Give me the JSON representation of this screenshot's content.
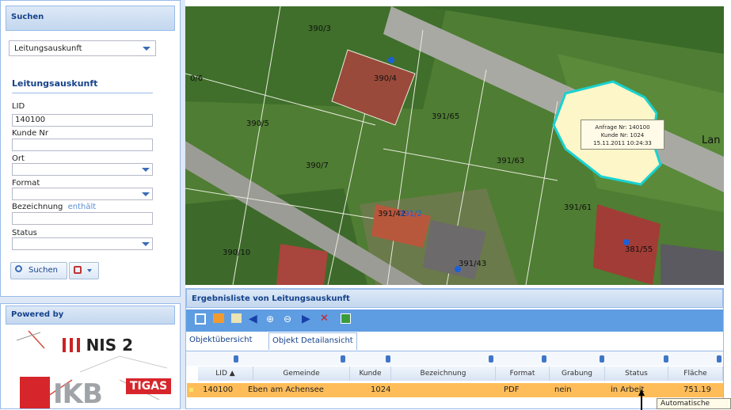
{
  "search_panel": {
    "title": "Suchen",
    "type_select": "Leitungsauskunft",
    "section_title": "Leitungsauskunft",
    "lid_label": "LID",
    "lid_value": "140100",
    "kunde_label": "Kunde Nr",
    "ort_label": "Ort",
    "format_label": "Format",
    "bez_label": "Bezeichnung",
    "bez_hint": "enthält",
    "status_label": "Status",
    "search_button": "Suchen"
  },
  "powered_panel": {
    "title": "Powered by",
    "nis_logo": "NIS 2",
    "ikb_logo": "IKB",
    "tigas_logo": "TIGAS"
  },
  "map": {
    "parcels": [
      "390/3",
      "390/4",
      "390/5",
      "390/7",
      "390/10",
      "391/65",
      "391/63",
      "391/61",
      "391/43",
      "381/55",
      "391/42",
      "391/2"
    ],
    "edge_label_left": "0/6",
    "edge_label_right": "Lan",
    "tooltip": [
      "Anfrage Nr: 140100",
      "Kunde Nr: 1024",
      "15.11.2011 10:24:33"
    ],
    "colors": {
      "selection_fill": "#fdf6c8",
      "selection_outline": "#18d2d0"
    }
  },
  "results": {
    "title": "Ergebnisliste von Leitungsauskunft",
    "tabs": [
      "Objektübersicht",
      "Objekt Detailansicht"
    ],
    "columns": [
      "LID ▲",
      "Gemeinde",
      "Kunde",
      "Bezeichnung",
      "Format",
      "Grabung",
      "Status",
      "Fläche"
    ],
    "rows": [
      [
        "140100",
        "Eben am Achensee",
        "1024",
        "",
        "PDF",
        "nein",
        "in Arbeit",
        "751.19"
      ]
    ],
    "tooltip_partial": "Automatische"
  },
  "colors": {
    "accent": "#15428b",
    "row_highlight": "#ffbd59",
    "toolbar": "#5f9de2"
  }
}
